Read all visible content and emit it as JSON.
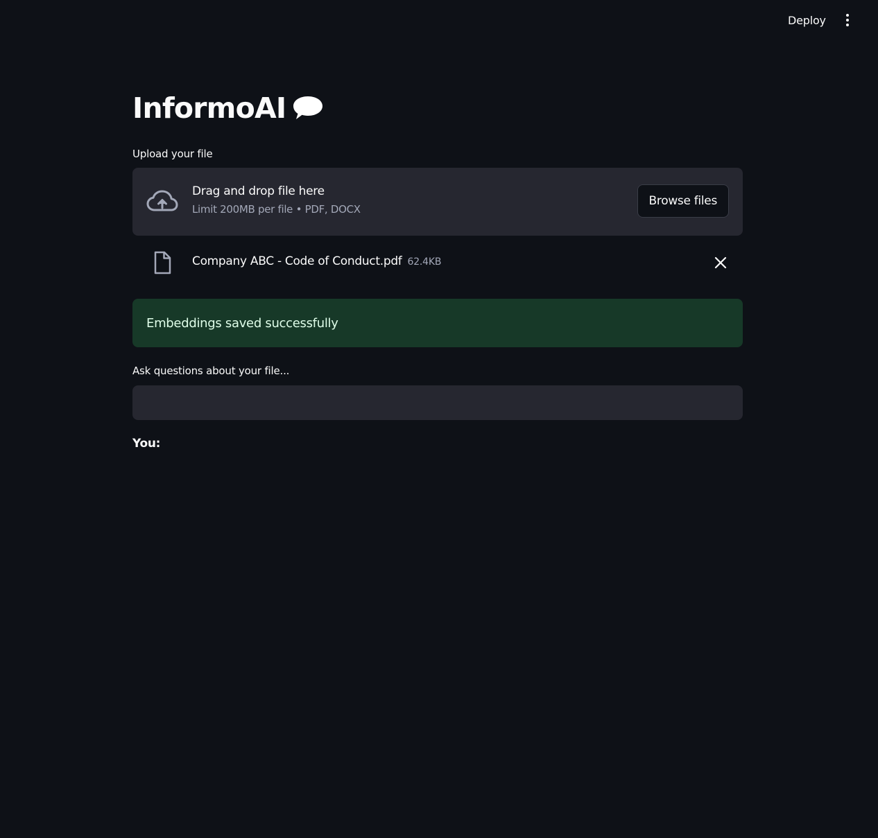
{
  "header": {
    "deploy_label": "Deploy",
    "menu_icon": "kebab-vertical-icon"
  },
  "app": {
    "title": "InformoAI",
    "title_icon": "speech-bubble-icon"
  },
  "uploader": {
    "label": "Upload your file",
    "drop_title": "Drag and drop file here",
    "drop_subtitle": "Limit 200MB per file • PDF, DOCX",
    "browse_label": "Browse files",
    "icon": "cloud-upload-icon"
  },
  "uploaded_file": {
    "name": "Company ABC - Code of Conduct.pdf",
    "size": "62.4KB",
    "icon": "file-icon"
  },
  "alert": {
    "message": "Embeddings saved successfully",
    "color": "#173928"
  },
  "question": {
    "label": "Ask questions about your file...",
    "value": "",
    "placeholder": ""
  },
  "chat": {
    "you_label": "You:"
  },
  "colors": {
    "background": "#0e1117",
    "surface": "#262730",
    "text": "#fafafa",
    "muted": "#a3a8b8"
  }
}
